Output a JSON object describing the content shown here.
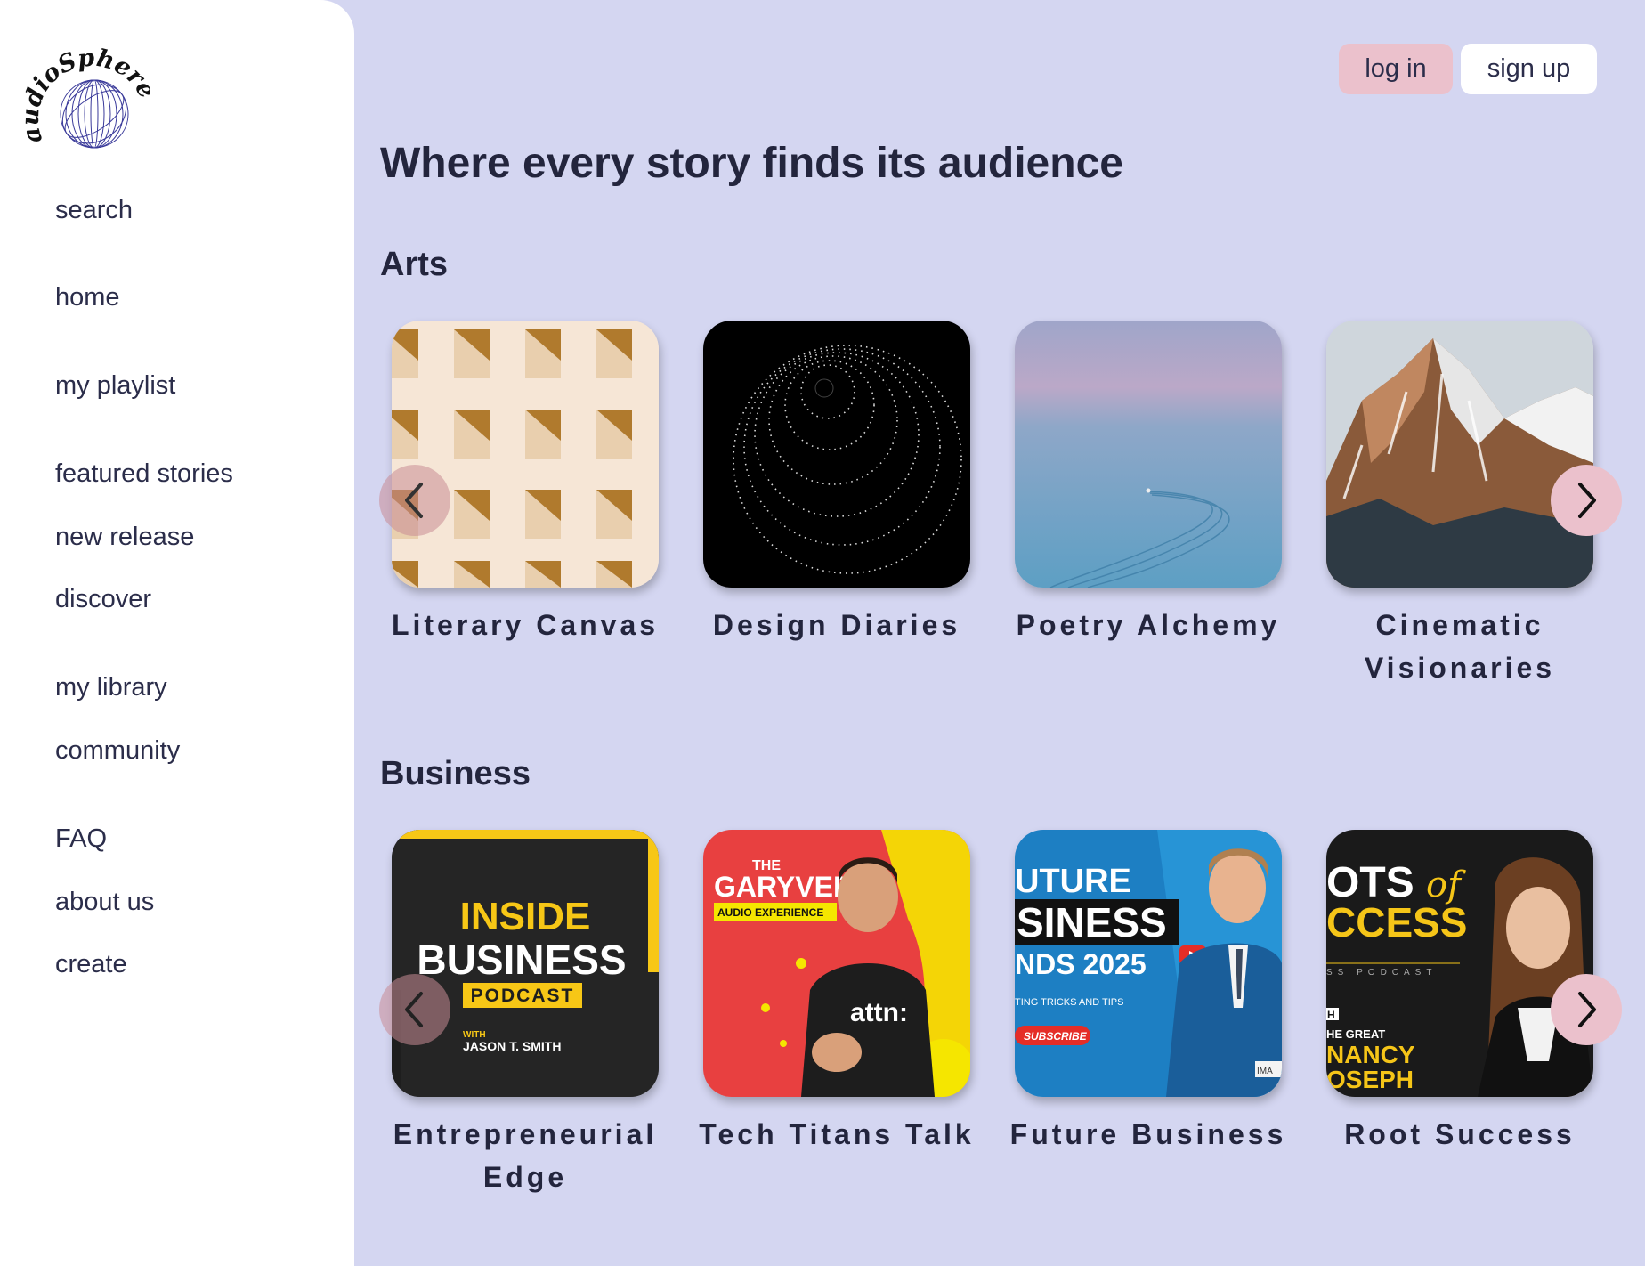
{
  "brand": {
    "name_top": "audio",
    "name_arc": "Sphere",
    "accent_color": "#ebc1cc",
    "background_color": "#d4d6f1"
  },
  "sidebar": {
    "items": [
      {
        "label": "search"
      },
      {
        "label": "home"
      },
      {
        "label": "my playlist"
      },
      {
        "label": "featured stories"
      },
      {
        "label": "new release"
      },
      {
        "label": "discover"
      },
      {
        "label": "my library"
      },
      {
        "label": "community"
      },
      {
        "label": "FAQ"
      },
      {
        "label": "about us"
      },
      {
        "label": "create"
      }
    ]
  },
  "header": {
    "login_label": "log in",
    "signup_label": "sign up",
    "title": "Where every story finds its audience"
  },
  "sections": [
    {
      "title": "Arts",
      "cards": [
        {
          "title": "Literary Canvas",
          "image": "cream-facade-windows"
        },
        {
          "title": "Design Diaries",
          "image": "dotted-sphere-black"
        },
        {
          "title": "Poetry Alchemy",
          "image": "calm-sea-boat-wake"
        },
        {
          "title": "Cinematic Visionaries",
          "image": "snowy-mountain"
        }
      ]
    },
    {
      "title": "Business",
      "cards": [
        {
          "title": "Entrepreneurial Edge",
          "image": "inside-business-podcast-cover",
          "cover_text": [
            "INSIDE",
            "BUSINESS",
            "PODCAST",
            "WITH",
            "JASON T. SMITH"
          ]
        },
        {
          "title": "Tech Titans Talk",
          "image": "garyvee-audio-experience-cover",
          "cover_text": [
            "THE",
            "GARYVEE",
            "AUDIO EXPERIENCE",
            "attn:"
          ]
        },
        {
          "title": "Future Business",
          "image": "future-business-trends-cover",
          "cover_text": [
            "UTURE",
            "SINESS",
            "NDS 2025",
            "TING TRICKS AND TIPS",
            "SUBSCRIBE",
            "IMA"
          ]
        },
        {
          "title": "Root Success",
          "image": "roots-of-success-cover",
          "cover_text": [
            "OTS",
            "of",
            "CCESS",
            "SS PODCAST",
            "H",
            "HE GREAT",
            "NANCY",
            "OSEPH"
          ]
        }
      ]
    }
  ],
  "icons": {
    "prev": "chevron-left-icon",
    "next": "chevron-right-icon"
  }
}
